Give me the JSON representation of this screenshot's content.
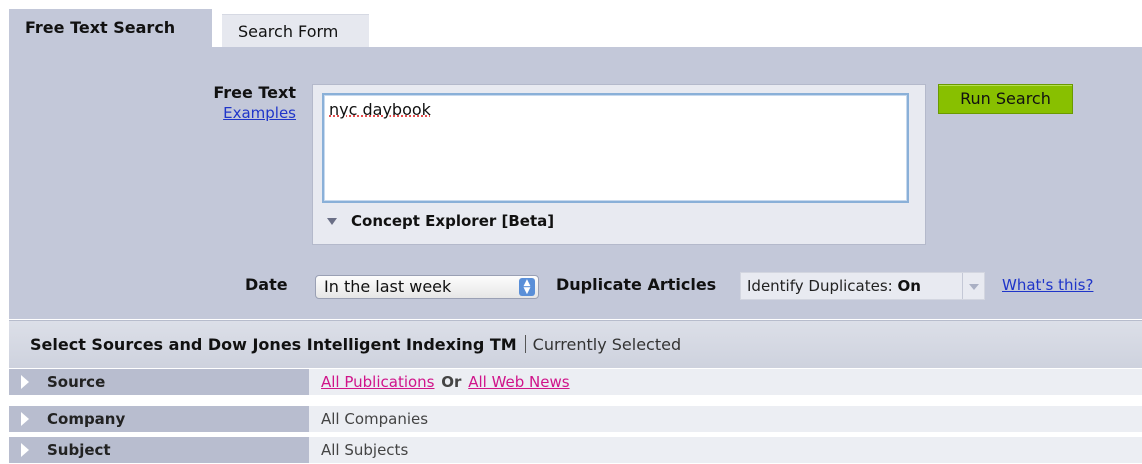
{
  "tabs": {
    "active": "Free Text Search",
    "inactive": "Search Form"
  },
  "free_text": {
    "label": "Free Text",
    "examples_link": "Examples",
    "value": "nyc daybook",
    "concept_explorer": "Concept Explorer [Beta]"
  },
  "run_search": "Run Search",
  "date": {
    "label": "Date",
    "selected": "In the last week"
  },
  "duplicates": {
    "label": "Duplicate Articles",
    "select_prefix": "Identify Duplicates: ",
    "select_value": "On",
    "whats_this": "What's this?"
  },
  "sources": {
    "heading": "Select Sources and Dow Jones Intelligent Indexing TM",
    "currently_selected": "Currently Selected",
    "rows": [
      {
        "label": "Source",
        "link1": "All Publications",
        "or": "Or",
        "link2": "All Web News"
      },
      {
        "label": "Company",
        "value": "All Companies"
      },
      {
        "label": "Subject",
        "value": "All Subjects"
      }
    ]
  },
  "colors": {
    "panel": "#c3c8d9",
    "run_button": "#88c000",
    "link": "#1f35c9",
    "source_link": "#d0148a"
  }
}
